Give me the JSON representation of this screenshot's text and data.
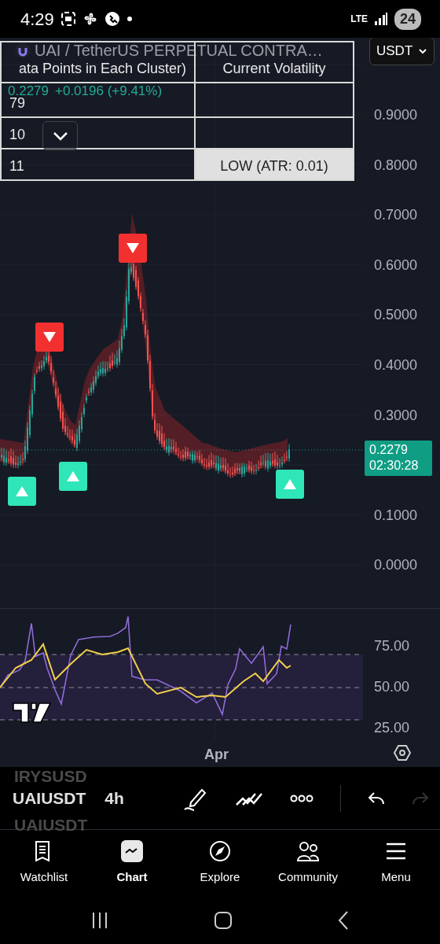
{
  "status_bar": {
    "time": "4:29",
    "network": "LTE",
    "battery": "24"
  },
  "chart": {
    "title": "UAI / TetherUS PERPETUAL CONTRA…",
    "quote": "0.2279",
    "change": "+0.0196 (+9.41%)",
    "currency": "USDT",
    "price_axis_upper": [
      "0.9000",
      "0.8000",
      "0.7000",
      "0.6000",
      "0.5000",
      "0.4000",
      "0.3000"
    ],
    "price_axis_lower": [
      "0.1000",
      "0.0000"
    ],
    "price_tag": {
      "price": "0.2279",
      "countdown": "02:30:28"
    },
    "rsi_axis": [
      "75.00",
      "50.00",
      "25.00"
    ],
    "time_axis": [
      "Apr"
    ]
  },
  "table": {
    "columns": [
      "ata Points in Each Cluster)",
      "Current Volatility"
    ],
    "rows": [
      {
        "cells": [
          "79",
          ""
        ],
        "highlighted": false
      },
      {
        "cells": [
          "10",
          ""
        ],
        "highlighted": false
      },
      {
        "cells": [
          "11",
          "LOW (ATR: 0.01)"
        ],
        "highlighted": true
      }
    ]
  },
  "toolbar": {
    "symbol_above": "IRYSUSD",
    "symbol": "UAIUSDT",
    "symbol_below": "UAIUSDT",
    "interval": "4h",
    "redo_disabled": true
  },
  "tabs": [
    {
      "kind": "watchlist",
      "label": "Watchlist",
      "selected": false
    },
    {
      "kind": "chart",
      "label": "Chart",
      "selected": true
    },
    {
      "kind": "explore",
      "label": "Explore",
      "selected": false
    },
    {
      "kind": "community",
      "label": "Community",
      "selected": false
    },
    {
      "kind": "menu",
      "label": "Menu",
      "selected": false
    }
  ]
}
